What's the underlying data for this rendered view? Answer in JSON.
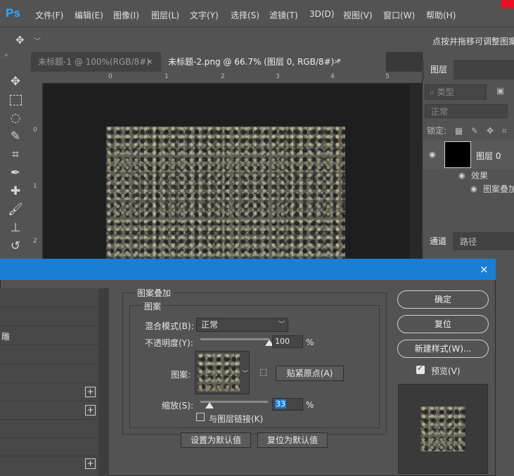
{
  "app": {
    "logo": "Ps"
  },
  "menu": [
    "文件(F)",
    "编辑(E)",
    "图像(I)",
    "图层(L)",
    "文字(Y)",
    "选择(S)",
    "滤镜(T)",
    "3D(D)",
    "视图(V)",
    "窗口(W)",
    "帮助(H)"
  ],
  "options_bar": {
    "hint": "点按并拖移可调整图案"
  },
  "tabs": [
    {
      "label": "未标题-1 @ 100%(RGB/8#)",
      "close": "×"
    },
    {
      "label": "未标题-2.png @ 66.7% (图层 0, RGB/8#) *",
      "close": "×"
    }
  ],
  "ruler_top": [
    "0",
    "1",
    "2",
    "3",
    "4",
    "5"
  ],
  "ruler_left": [
    "0",
    "1",
    "2"
  ],
  "layers_panel": {
    "tab": "图层",
    "kind_filter": "类型",
    "blend_mode": "正常",
    "lock_label": "锁定:",
    "layer_name": "图层 0",
    "effects_label": "效果",
    "effect_item": "图案叠加"
  },
  "channels_panel": {
    "tab_channels": "通道",
    "tab_paths": "路径"
  },
  "dialog": {
    "close": "×",
    "left_list": {
      "item_label": "雕"
    },
    "section_title": "图案叠加",
    "subsection_title": "图案",
    "blend_mode_label": "混合模式(B):",
    "blend_mode_value": "正常",
    "opacity_label": "不透明度(Y):",
    "opacity_value": "100",
    "opacity_level": 100,
    "percent": "%",
    "pattern_label": "图案:",
    "snap_origin_button": "贴紧原点(A)",
    "scale_label": "缩放(S):",
    "scale_value": "33",
    "scale_level": 33,
    "link_with_layer": "与图层链接(K)",
    "set_default_button": "设置为默认值",
    "reset_default_button": "复位为默认值",
    "ok_button": "确定",
    "reset_button": "复位",
    "new_style_button": "新建样式(W)...",
    "preview_label": "预览(V)",
    "preview_checked": true
  },
  "colors": {
    "accent": "#1a7fd4",
    "ps_logo": "#31a8ff",
    "close_red": "#e81123"
  }
}
